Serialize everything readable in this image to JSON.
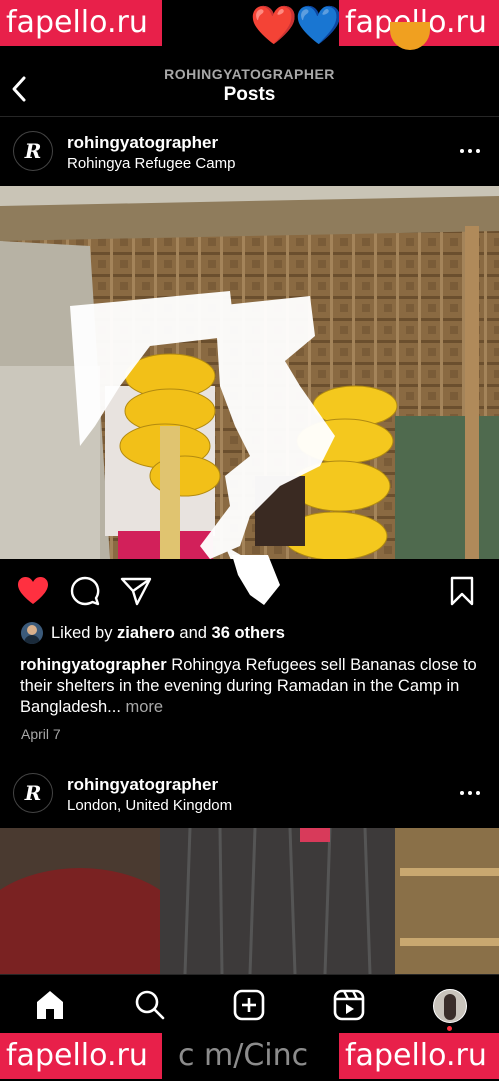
{
  "watermark": {
    "text": "fapello.ru",
    "bottom_text": "c m/Cinc"
  },
  "status_emoji": {
    "red_heart": "❤️",
    "blue_heart": "💙"
  },
  "header": {
    "account": "ROHINGYATOGRAPHER",
    "title": "Posts"
  },
  "post1": {
    "username": "rohingyatographer",
    "location": "Rohingya Refugee Camp",
    "avatar_letter": "R",
    "liked_prefix": "Liked by ",
    "liked_user": "ziahero",
    "liked_and": " and ",
    "liked_others": "36 others",
    "caption_user": "rohingyatographer",
    "caption_text": " Rohingya Refugees sell Bananas close to their shelters in the evening during Ramadan in the Camp in Bangladesh...",
    "more": " more",
    "date": "April 7"
  },
  "post2": {
    "username": "rohingyatographer",
    "location": "London, United Kingdom",
    "avatar_letter": "R"
  },
  "colors": {
    "like_red": "#ff3040",
    "watermark": "#e8204a",
    "muted": "#a8a8a8"
  },
  "icons": [
    "back-chevron-icon",
    "more-dots-icon",
    "heart-filled-icon",
    "comment-icon",
    "share-icon",
    "bookmark-icon",
    "home-icon",
    "search-icon",
    "create-post-icon",
    "reels-icon",
    "profile-avatar"
  ]
}
